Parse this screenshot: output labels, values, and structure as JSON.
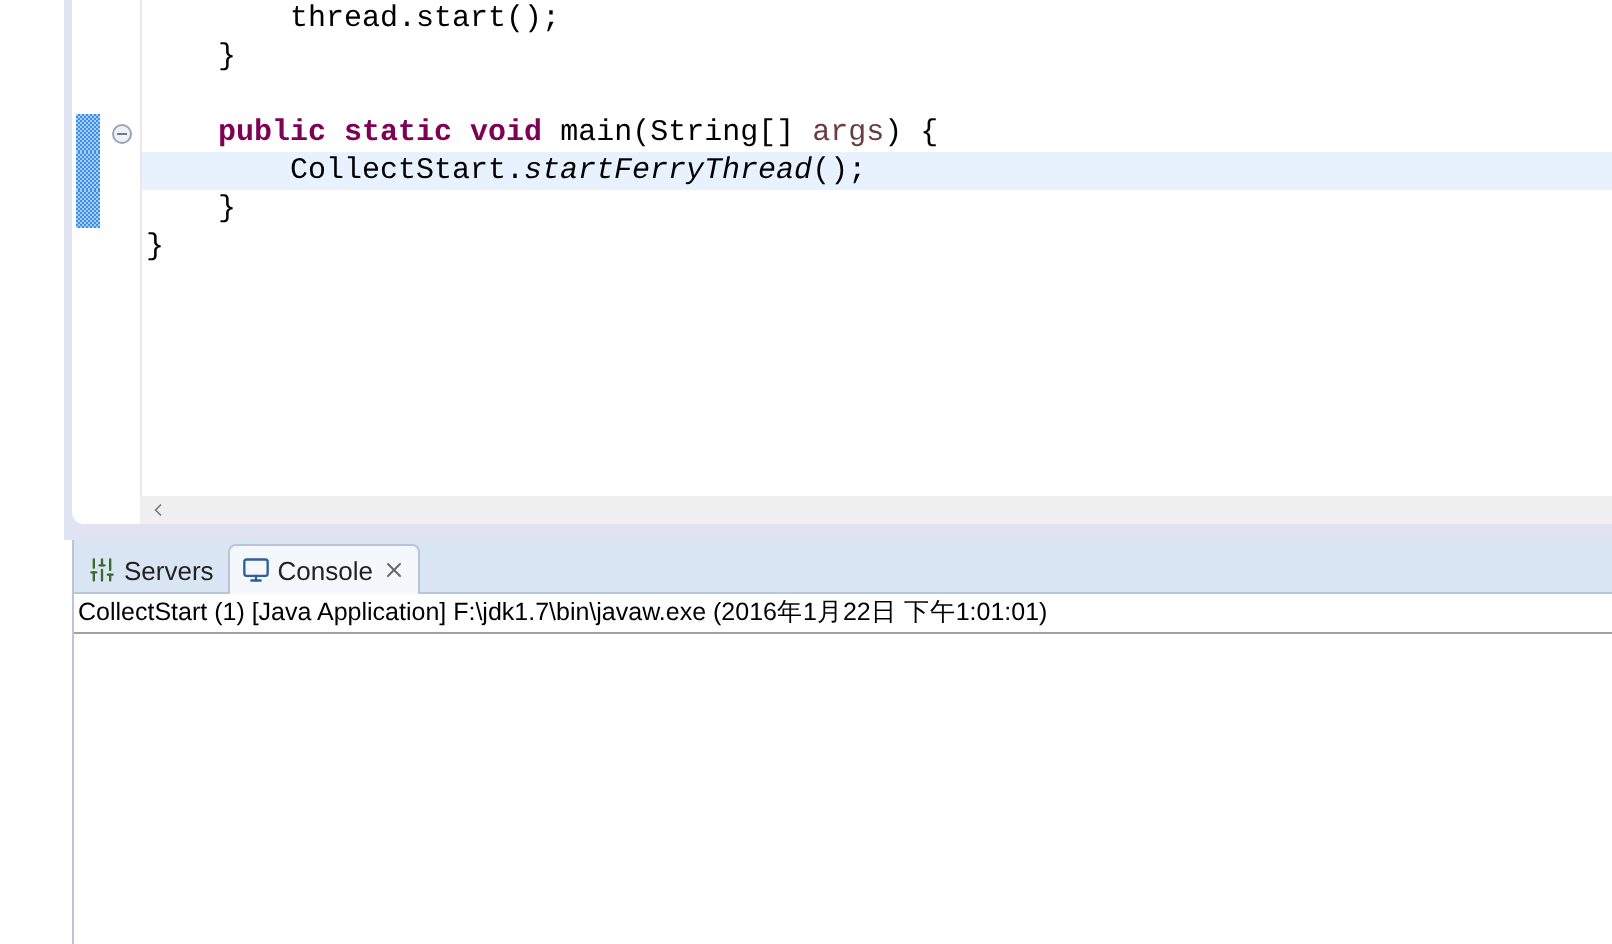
{
  "editor": {
    "lines": [
      {
        "current": false,
        "changed": false,
        "fold": false,
        "tokens": [
          {
            "kind": "plain",
            "text": "        thread.start();"
          }
        ]
      },
      {
        "current": false,
        "changed": false,
        "fold": false,
        "tokens": [
          {
            "kind": "plain",
            "text": "    }"
          }
        ]
      },
      {
        "current": false,
        "changed": false,
        "fold": false
      },
      {
        "current": false,
        "changed": true,
        "fold": true,
        "tokens": [
          {
            "kind": "keyword",
            "text": "    public "
          },
          {
            "kind": "keyword",
            "text": "static "
          },
          {
            "kind": "keyword",
            "text": "void "
          },
          {
            "kind": "plain",
            "text": "main(String[] "
          },
          {
            "kind": "param",
            "text": "args"
          },
          {
            "kind": "plain",
            "text": ") {"
          }
        ]
      },
      {
        "current": true,
        "changed": true,
        "fold": false,
        "tokens": [
          {
            "kind": "plain",
            "text": "        CollectStart."
          },
          {
            "kind": "static-call",
            "text": "startFerryThread"
          },
          {
            "kind": "plain",
            "text": "();"
          }
        ]
      },
      {
        "current": false,
        "changed": true,
        "fold": false,
        "tokens": [
          {
            "kind": "plain",
            "text": "    }"
          }
        ]
      },
      {
        "current": false,
        "changed": false,
        "fold": false,
        "tokens": [
          {
            "kind": "plain",
            "text": "}"
          }
        ]
      }
    ]
  },
  "console_panel": {
    "tabs": [
      {
        "label": "Servers",
        "kind": "servers",
        "selected": false,
        "closable": false
      },
      {
        "label": "Console",
        "kind": "console",
        "selected": true,
        "closable": true
      }
    ],
    "description": "CollectStart (1) [Java Application] F:\\jdk1.7\\bin\\javaw.exe (2016年1月22日 下午1:01:01)"
  }
}
